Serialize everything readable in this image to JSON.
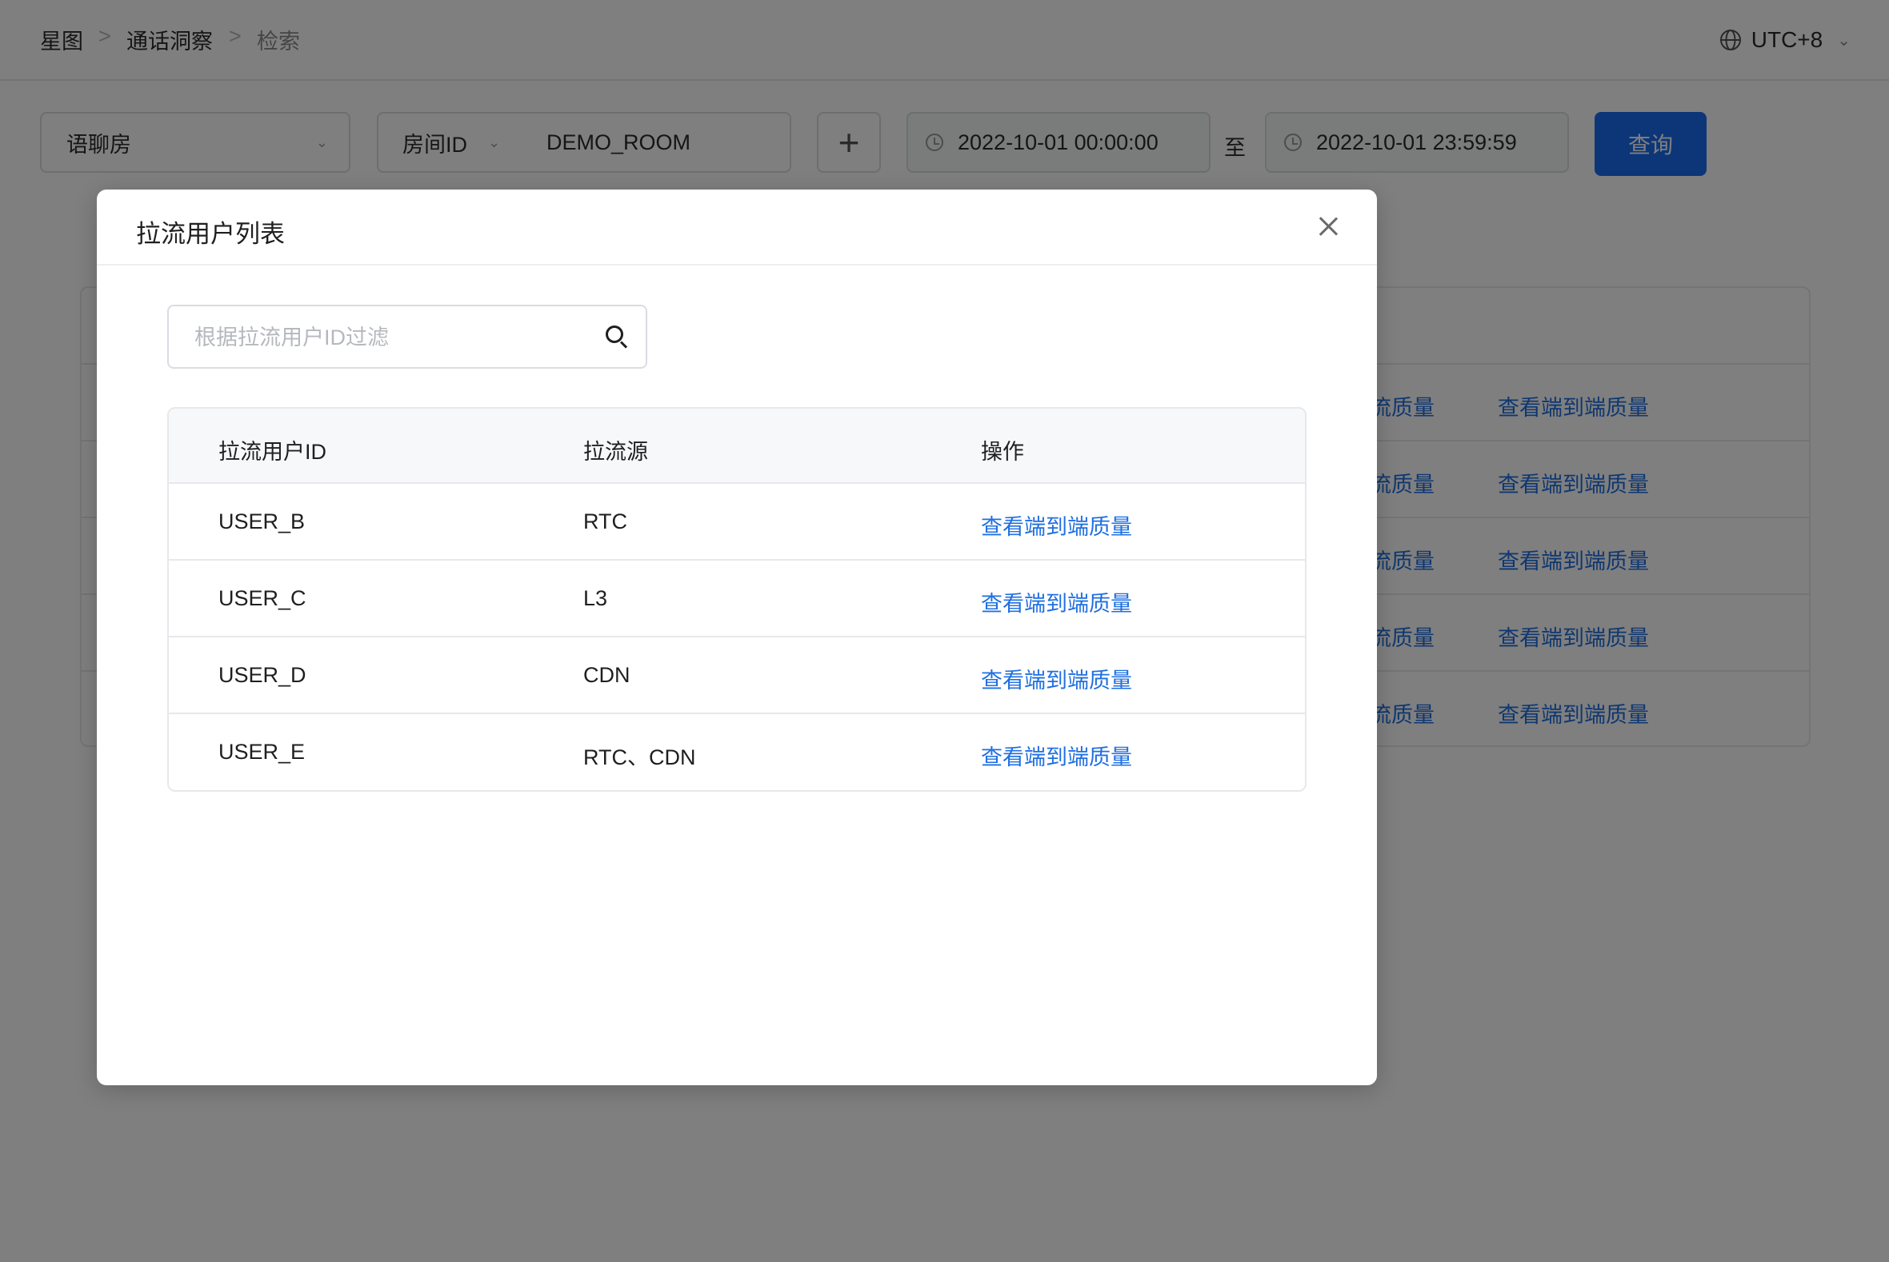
{
  "breadcrumb": [
    "星图",
    "通话洞察",
    "检索"
  ],
  "timezone": "UTC+8",
  "filters": {
    "scene": "语聊房",
    "id_type": "房间ID",
    "id_value": "DEMO_ROOM",
    "start_time": "2022-10-01 00:00:00",
    "to_label": "至",
    "end_time": "2022-10-01 23:59:59",
    "query_label": "查询",
    "add_symbol": "+"
  },
  "background_table": {
    "partial_link": "流质量",
    "link": "查看端到端质量"
  },
  "modal": {
    "title": "拉流用户列表",
    "search_placeholder": "根据拉流用户ID过滤",
    "columns": [
      "拉流用户ID",
      "拉流源",
      "操作"
    ],
    "rows": [
      {
        "user_id": "USER_B",
        "source": "RTC",
        "action": "查看端到端质量"
      },
      {
        "user_id": "USER_C",
        "source": "L3",
        "action": "查看端到端质量"
      },
      {
        "user_id": "USER_D",
        "source": "CDN",
        "action": "查看端到端质量"
      },
      {
        "user_id": "USER_E",
        "source": "RTC、CDN",
        "action": "查看端到端质量"
      }
    ]
  },
  "colors": {
    "primary": "#1a6df0",
    "link": "#1f6fe0",
    "mask": "rgba(0,0,0,0.5)"
  }
}
